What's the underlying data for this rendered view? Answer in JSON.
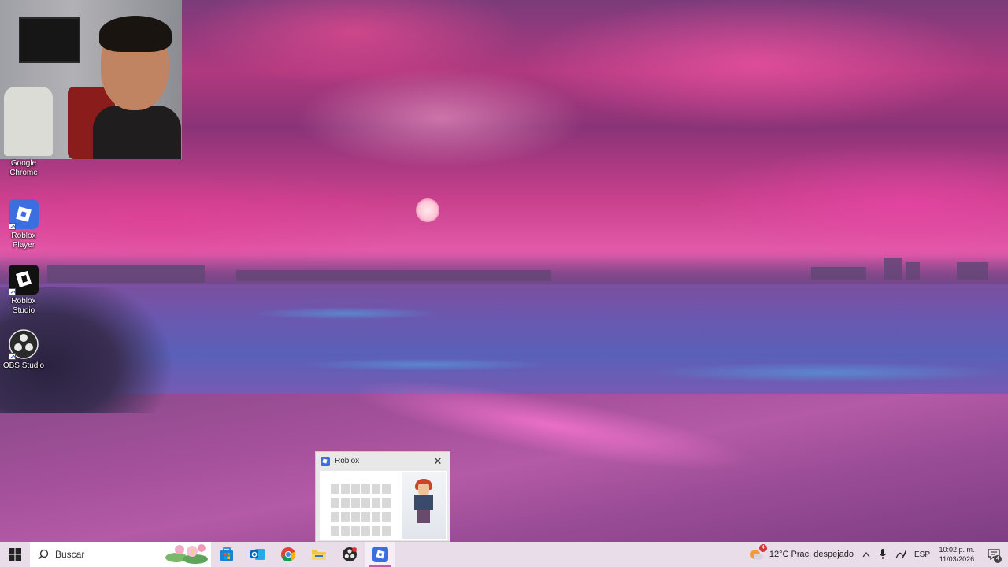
{
  "desktop": {
    "icons": [
      {
        "name": "chrome",
        "label": "Google Chrome"
      },
      {
        "name": "roblox-player",
        "label": "Roblox Player"
      },
      {
        "name": "roblox-studio",
        "label": "Roblox Studio"
      },
      {
        "name": "obs",
        "label": "OBS Studio"
      }
    ]
  },
  "preview": {
    "title": "Roblox",
    "close_glyph": "✕"
  },
  "taskbar": {
    "search_placeholder": "Buscar",
    "apps": [
      "store-icon",
      "outlook-icon",
      "chrome-icon",
      "file-explorer-icon",
      "obs-icon",
      "roblox-icon"
    ],
    "weather": {
      "badge": "4",
      "text": "12°C  Prac. despejado"
    },
    "language": "ESP",
    "time": "10:02 p. m.",
    "date": "11/03/2026",
    "notification_count": "4"
  },
  "colors": {
    "taskbar_bg": "#e9dde9",
    "accent": "#c45aa4",
    "roblox_blue": "#3b6fe0"
  }
}
